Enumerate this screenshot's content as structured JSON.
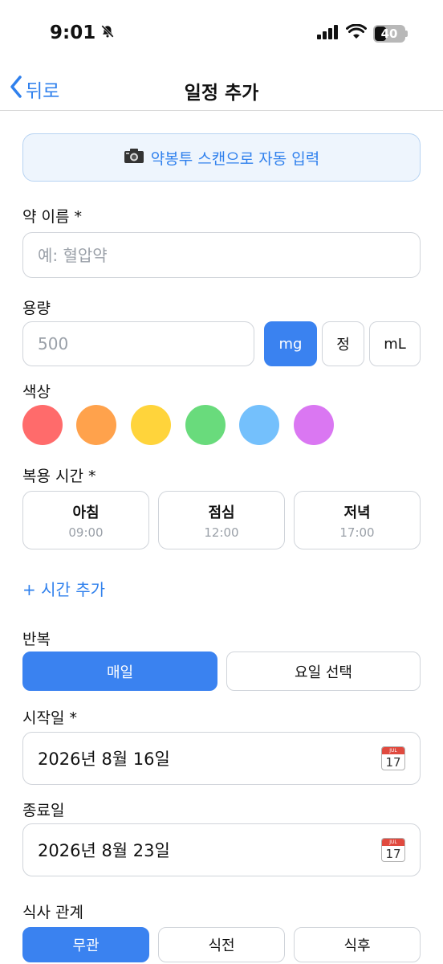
{
  "status": {
    "time": "9:01",
    "battery": "40",
    "battery_level_percent": 40
  },
  "nav": {
    "back_label": "뒤로",
    "title": "일정 추가"
  },
  "scan": {
    "label": "약봉투 스캔으로 자동 입력"
  },
  "medicine": {
    "label": "약 이름 *",
    "placeholder": "예: 혈압약"
  },
  "dose": {
    "label": "용량",
    "placeholder": "500",
    "units": [
      "mg",
      "정",
      "mL"
    ],
    "selected_unit": "mg"
  },
  "color": {
    "label": "색상",
    "swatches": [
      "#ff6b6b",
      "#ffa24c",
      "#ffd43b",
      "#69db7c",
      "#74c0fc",
      "#da77f2"
    ]
  },
  "times": {
    "label": "복용 시간 *",
    "items": [
      {
        "name": "아침",
        "time": "09:00"
      },
      {
        "name": "점심",
        "time": "12:00"
      },
      {
        "name": "저녁",
        "time": "17:00"
      }
    ],
    "add_label": "+ 시간 추가"
  },
  "repeat": {
    "label": "반복",
    "options": [
      "매일",
      "요일 선택"
    ],
    "selected": "매일"
  },
  "start_date": {
    "label": "시작일 *",
    "value": "2026년 8월 16일"
  },
  "end_date": {
    "label": "종료일",
    "value": "2026년 8월 23일"
  },
  "calendar_icon": {
    "month": "JUL",
    "day": "17"
  },
  "meal": {
    "label": "식사 관계",
    "options": [
      "무관",
      "식전",
      "식후"
    ],
    "selected": "무관"
  },
  "colors": {
    "accent": "#3a82f0",
    "link": "#2f80ed",
    "border": "#d0d4da"
  }
}
